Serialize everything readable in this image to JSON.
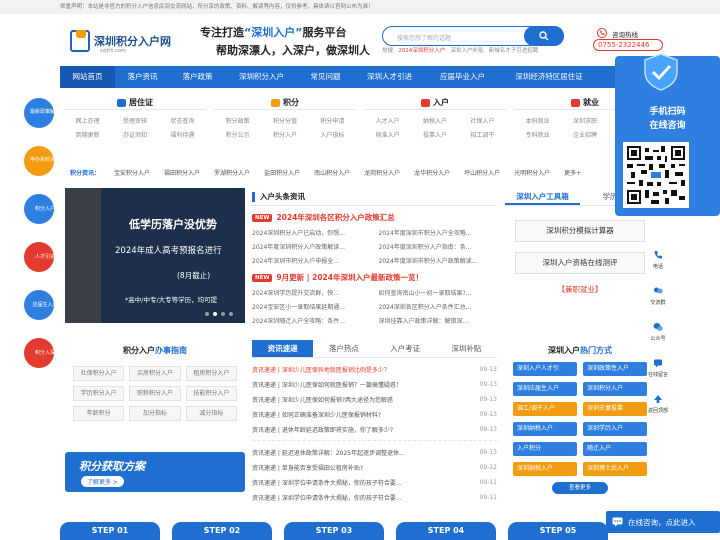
{
  "top_notice": "郑重声明：本站是非官方的积分入户信息民间交流网站，所分享的政策、资料、解读等内容，仅供参考，具体请以官网公布为准！",
  "logo": {
    "text": "深圳积分入户网",
    "sub": "szjfrh.com"
  },
  "slogan": {
    "line1_pre": "专注打造",
    "line1_hl": "“深圳入户”",
    "line1_post": "服务平台",
    "line2": "帮助深漂人，入深户，做深圳人"
  },
  "search": {
    "placeholder": "搜索您想了解的话题"
  },
  "hot_search": {
    "label": "热搜",
    "items": [
      "2024深圳积分入户",
      "深圳入户补贴",
      "新域名才子引进招聘"
    ]
  },
  "hotline": {
    "label": "咨询热线",
    "number": "0755-2322446"
  },
  "nav": [
    "网站首页",
    "落户资讯",
    "落户政策",
    "深圳积分入户",
    "常见问题",
    "深圳人才引进",
    "应届毕业入户",
    "深圳经济特区居住证",
    "深圳"
  ],
  "categories": [
    {
      "title": "居住证",
      "color": "#1e6fd0",
      "items": [
        "网上办理",
        "受理审核",
        "状态查询",
        "到期更新",
        "办证须知",
        "福利待遇"
      ]
    },
    {
      "title": "积分",
      "color": "#f39c12",
      "items": [
        "积分政策",
        "积分分值",
        "积分申请",
        "积分公示",
        "积分入户",
        "入户指标"
      ]
    },
    {
      "title": "入户",
      "color": "#e23a2e",
      "items": [
        "人才入户",
        "纳税入户",
        "社保入户",
        "核准入户",
        "投靠入户",
        "招工调干"
      ]
    },
    {
      "title": "就业",
      "color": "#e23a2e",
      "items": [
        "本科就业",
        "深圳求职",
        "招聘",
        "专科就业",
        "企业招聘",
        "面试"
      ]
    }
  ],
  "jf_row": {
    "label": "积分资讯：",
    "items": [
      "宝安积分入户",
      "福田积分入户",
      "罗湖积分入户",
      "盐田积分入户",
      "南山积分入户",
      "龙岗积分入户",
      "龙华积分入户",
      "坪山积分入户",
      "光明积分入户",
      "更多+"
    ]
  },
  "left_sidebar": [
    {
      "label": "最新政策解读",
      "color": "#2f7fe0"
    },
    {
      "label": "申办资料清单",
      "color": "#f39c12"
    },
    {
      "label": "积分入户",
      "color": "#2f7fe0"
    },
    {
      "label": "人才引进",
      "color": "#e23a2e"
    },
    {
      "label": "应届生入户",
      "color": "#2f7fe0"
    },
    {
      "label": "积分入深",
      "color": "#e23a2e"
    }
  ],
  "banner": {
    "line1": "低学历落户没优势",
    "line2": "2024年成人高考预报名进行",
    "line3": "(8月截止)",
    "line4": "*高中/中专/大专等学历，均可提"
  },
  "news": {
    "heading": "入户头条资讯",
    "blocks": [
      {
        "badge": "NEW",
        "title": "2024年深圳各区积分入户政策汇总",
        "items": [
          "2024深圳积分入户已启动，你想...",
          "2024年度深圳市积分入户全攻略...",
          "2024年度深圳积分入户政策解读...",
          "2024年度深圳积分入户指南：条...",
          "2024年深圳市积分入户申报全...",
          "2024年度深圳市积分入户政策解读..."
        ]
      },
      {
        "badge": "NEW",
        "title": "9月更新 | 2024年深圳入户最新政策一览！",
        "items": [
          "2024深圳学历提升交流群，快...",
          "如何查询南山小一初一录取结果?...",
          "2024宝安区小一录取结果延期通...",
          "2024深圳各区积分入户条件汇总...",
          "2024深圳随迁入户全攻略：条件...",
          "深圳挂靠入户政策详解：解锁深..."
        ]
      }
    ]
  },
  "tools": {
    "tabs": [
      "深圳入户工具箱",
      "学历提升"
    ],
    "buttons": [
      "深圳积分模拟计算器",
      "深圳入户资格在线测评",
      "【兼职就业】"
    ]
  },
  "guide": {
    "heading_pre": "积分入户",
    "heading_hl": "办事指南",
    "items": [
      "社保积分入户",
      "买房积分入户",
      "租房积分入户",
      "学历积分入户",
      "职称积分入户",
      "技能积分入户",
      "年龄积分",
      "加分指标",
      "减分指标"
    ]
  },
  "jf_banner": {
    "title": "积分获取方案",
    "btn": "了解更多 >"
  },
  "tabs2": {
    "tabs": [
      "资讯速递",
      "落户热点",
      "入户考证",
      "深圳补贴"
    ],
    "group1": [
      {
        "t": "资讯速递 | 深圳少儿医保异地就医报销比例是多少？",
        "d": "09-13"
      },
      {
        "t": "资讯速递 | 深圳少儿医保如何就医报销？一篇搞懂疑惑！",
        "d": "09-13"
      },
      {
        "t": "资讯速递 | 深圳少儿医保如何报销?两大途径为您解惑",
        "d": "09-13"
      },
      {
        "t": "资讯速递 | 如何正确准备深圳少儿医保报销材料?",
        "d": "09-13"
      },
      {
        "t": "资讯速递 | 退休年龄延迟政策即将实施，你了解多少?",
        "d": "09-13"
      }
    ],
    "group2": [
      {
        "t": "资讯速递 | 延迟退休政策详解：2025年起逐步调整退休...",
        "d": "09-13"
      },
      {
        "t": "资讯速递 | 单身能否享受福田公租房补贴?",
        "d": "09-12"
      },
      {
        "t": "资讯速递 | 深圳学位申请条件大揭秘，你的孩子符合要...",
        "d": "09-11"
      },
      {
        "t": "资讯速递 | 深圳学位申请条件大揭秘，你的孩子符合要...",
        "d": "09-11"
      }
    ]
  },
  "hot_cls": {
    "heading_pre": "深圳入户",
    "heading_hl": "热门方式",
    "items": [
      {
        "t": "深圳入户人才引",
        "c": "#2f7fe0"
      },
      {
        "t": "深圳政策性入户",
        "c": "#2f7fe0"
      },
      {
        "t": "深圳应届生入户",
        "c": "#2f7fe0"
      },
      {
        "t": "深圳积分入户",
        "c": "#2f7fe0"
      },
      {
        "t": "调工/调干入户",
        "c": "#f39c12"
      },
      {
        "t": "深圳夫妻投靠",
        "c": "#f39c12"
      },
      {
        "t": "深圳纳税入户",
        "c": "#2f7fe0"
      },
      {
        "t": "深圳学历入户",
        "c": "#2f7fe0"
      },
      {
        "t": "入户积分",
        "c": "#2f7fe0"
      },
      {
        "t": "随迁入户",
        "c": "#2f7fe0"
      },
      {
        "t": "深圳纳税入户",
        "c": "#f39c12"
      },
      {
        "t": "深圳博士后入户",
        "c": "#f39c12"
      }
    ],
    "more": "查看更多"
  },
  "steps": [
    "STEP 01",
    "STEP 02",
    "STEP 03",
    "STEP 04",
    "STEP 05"
  ],
  "qr_panel": {
    "line1": "手机扫码",
    "line2": "在线咨询"
  },
  "rail": [
    "电话",
    "交流群",
    "公众号",
    "在线留言",
    "返回顶部"
  ],
  "chat": {
    "label": "在线咨询，点此进入"
  }
}
